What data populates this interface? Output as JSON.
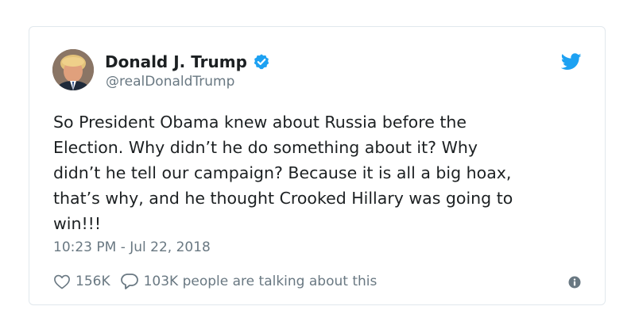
{
  "author": {
    "name": "Donald J. Trump",
    "handle": "@realDonaldTrump",
    "verified_icon": "verified-badge-icon",
    "avatar_icon": "avatar-photo"
  },
  "brand": {
    "icon": "twitter-bird-icon",
    "color": "#1da1f2"
  },
  "tweet": {
    "lines": [
      "So President Obama knew about Russia before the",
      "Election. Why didn’t he do something about it? Why",
      "didn’t he tell our campaign? Because it is all a big hoax,",
      "that’s why, and he thought Crooked Hillary was going to",
      "win!!!"
    ],
    "timestamp": "10:23 PM - Jul 22, 2018"
  },
  "actions": {
    "likes_count": "156K",
    "like_icon": "heart-icon",
    "reply_icon": "speech-bubble-icon",
    "talking_text": "103K people are talking about this",
    "info_icon": "info-icon"
  },
  "colors": {
    "text": "#1c2022",
    "muted": "#697882",
    "border": "#e1e8ed",
    "accent": "#1da1f2"
  }
}
